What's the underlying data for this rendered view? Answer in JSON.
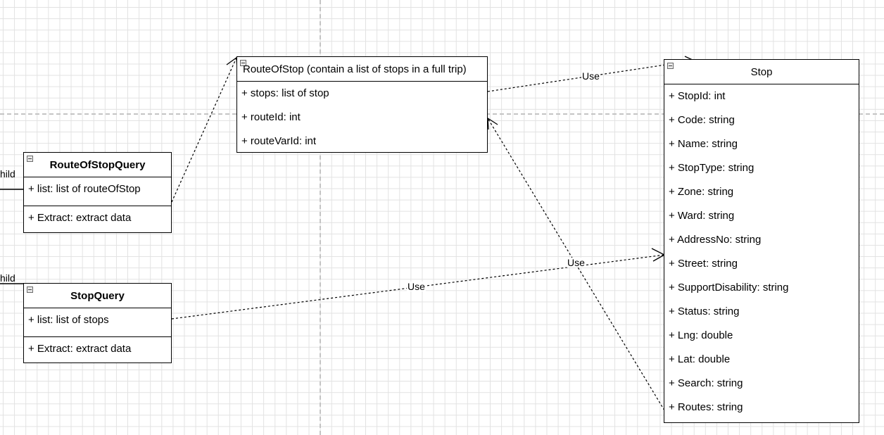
{
  "stubs": {
    "top_left": "hild",
    "bottom_left": "hild"
  },
  "classes": {
    "route_of_stop": {
      "title": "RouteOfStop (contain a list of stops in a full trip)",
      "attributes": [
        "+ stops: list of stop",
        "+ routeId: int",
        "+ routeVarId: int"
      ]
    },
    "route_of_stop_query": {
      "title": "RouteOfStopQuery",
      "attributes": [
        "+ list: list of routeOfStop"
      ],
      "methods": [
        "+ Extract: extract data"
      ]
    },
    "stop_query": {
      "title": "StopQuery",
      "attributes": [
        "+ list: list of stops"
      ],
      "methods": [
        "+ Extract: extract data"
      ]
    },
    "stop": {
      "title": "Stop",
      "attributes": [
        "+ StopId: int",
        "+ Code: string",
        "+ Name: string",
        "+ StopType: string",
        "+ Zone: string",
        "+ Ward: string",
        "+ AddressNo: string",
        "+ Street: string",
        "+ SupportDisability: string",
        "+ Status: string",
        "+ Lng: double",
        "+ Lat: double",
        "+ Search: string",
        "+ Routes: string"
      ]
    }
  },
  "edge_labels": {
    "routeofstop_to_stop": "Use",
    "stop_to_routeofstop": "Use",
    "stopquery_to_stop": "Use",
    "stopquery_to_stop_mid": "Use"
  }
}
